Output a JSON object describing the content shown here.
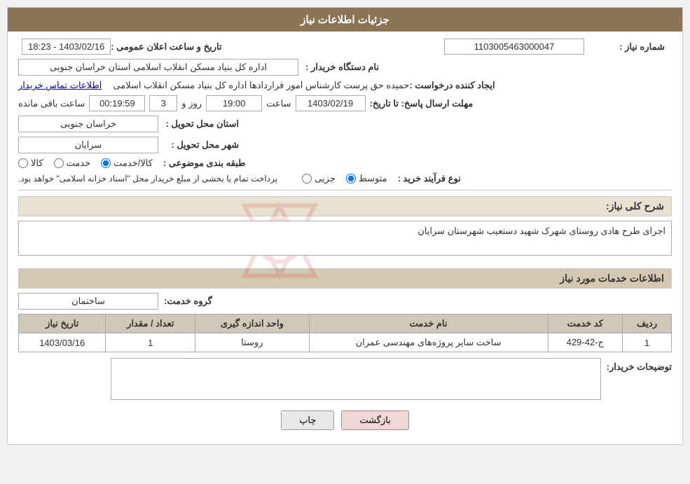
{
  "header": {
    "title": "جزئیات اطلاعات نیاز"
  },
  "fields": {
    "need_number_label": "شماره نیاز :",
    "need_number_value": "1103005463000047",
    "announce_label": "تاریخ و ساعت اعلان عمومی :",
    "announce_value": "1403/02/16 - 18:23",
    "buyer_label": "نام دستگاه خریدار :",
    "buyer_value": "اداره کل بنیاد مسکن انقلاب اسلامی استان خراسان جنوبی",
    "creator_label": "ایجاد کننده درخواست :",
    "creator_value": "حمیده حق پرست کارشناس امور قراردادها اداره کل بنیاد مسکن انقلاب اسلامی",
    "contact_link": "اطلاعات تماس خریدار",
    "deadline_label": "مهلت ارسال پاسخ: تا تاریخ:",
    "deadline_date": "1403/02/19",
    "deadline_time_label": "ساعت",
    "deadline_time": "19:00",
    "deadline_days_label": "روز و",
    "deadline_days": "3",
    "deadline_remaining_label": "ساعت باقی مانده",
    "deadline_remaining": "00:19:59",
    "province_label": "استان محل تحویل :",
    "province_value": "خراسان جنوبی",
    "city_label": "شهر محل تحویل :",
    "city_value": "سرایان",
    "category_label": "طبقه بندی موضوعی :",
    "category_options": [
      {
        "label": "کالا",
        "value": "kala",
        "checked": false
      },
      {
        "label": "خدمت",
        "value": "khedmat",
        "checked": false
      },
      {
        "label": "کالا/خدمت",
        "value": "kala_khedmat",
        "checked": true
      }
    ],
    "purchase_type_label": "نوع فرآیند خرید :",
    "purchase_type_options": [
      {
        "label": "جزیی",
        "value": "jozii",
        "checked": false
      },
      {
        "label": "متوسط",
        "value": "motevaset",
        "checked": true
      }
    ],
    "purchase_note": "پرداخت تمام یا بخشی از مبلغ خریداز محل \"اسناد خزانه اسلامی\" خواهد بود.",
    "need_desc_label": "شرح کلی نیاز:",
    "need_desc_value": "اجرای طرح هادی روستای شهرک شهید دستعیب شهرستان سرایان",
    "services_label": "اطلاعات خدمات مورد نیاز",
    "service_group_label": "گروه خدمت:",
    "service_group_value": "ساختمان",
    "table": {
      "headers": [
        "ردیف",
        "کد خدمت",
        "نام خدمت",
        "واحد اندازه گیری",
        "تعداد / مقدار",
        "تاریخ نیاز"
      ],
      "rows": [
        {
          "row": "1",
          "code": "ج-42-429",
          "name": "ساخت سایر پروژه‌های مهندسی عمران",
          "unit": "روستا",
          "qty": "1",
          "date": "1403/03/16"
        }
      ]
    },
    "buyer_desc_label": "توضیحات خریدار:",
    "buyer_desc_value": ""
  },
  "buttons": {
    "print": "چاپ",
    "back": "بازگشت"
  }
}
